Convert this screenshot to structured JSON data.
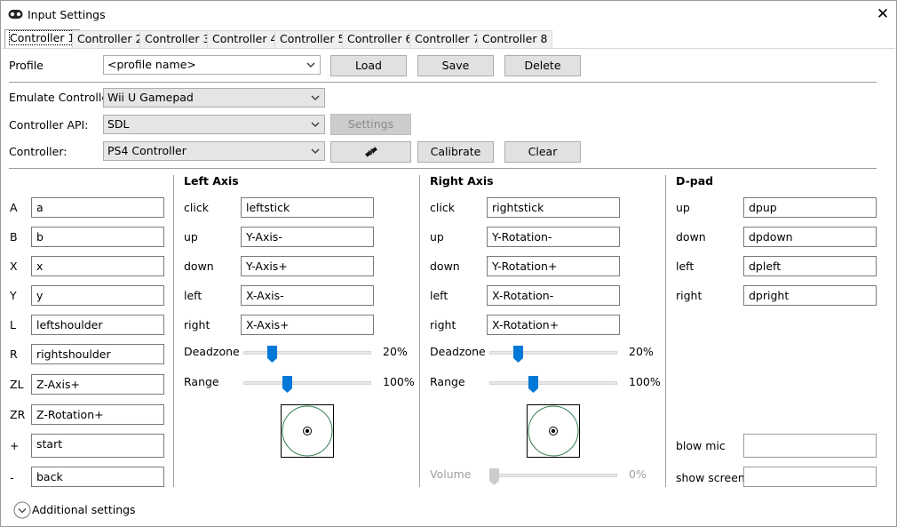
{
  "window": {
    "title": "Input Settings",
    "close_glyph": "✕"
  },
  "tabs": [
    {
      "label": "Controller 1",
      "active": true
    },
    {
      "label": "Controller 2"
    },
    {
      "label": "Controller 3"
    },
    {
      "label": "Controller 4"
    },
    {
      "label": "Controller 5"
    },
    {
      "label": "Controller 6"
    },
    {
      "label": "Controller 7"
    },
    {
      "label": "Controller 8"
    }
  ],
  "profile": {
    "label": "Profile",
    "value": "<profile name>",
    "load": "Load",
    "save": "Save",
    "delete": "Delete"
  },
  "emulate": {
    "label": "Emulate Controller",
    "value": "Wii U Gamepad"
  },
  "api": {
    "label": "Controller API:",
    "value": "SDL",
    "settings": "Settings"
  },
  "controller": {
    "label": "Controller:",
    "value": "PS4 Controller",
    "calibrate": "Calibrate",
    "clear": "Clear",
    "connect_icon": "connect-icon"
  },
  "buttons": [
    {
      "label": "A",
      "value": "a"
    },
    {
      "label": "B",
      "value": "b"
    },
    {
      "label": "X",
      "value": "x"
    },
    {
      "label": "Y",
      "value": "y"
    },
    {
      "label": "L",
      "value": "leftshoulder"
    },
    {
      "label": "R",
      "value": "rightshoulder"
    },
    {
      "label": "ZL",
      "value": "Z-Axis+"
    },
    {
      "label": "ZR",
      "value": "Z-Rotation+"
    },
    {
      "label": "+",
      "value": "start"
    },
    {
      "label": "-",
      "value": "back"
    }
  ],
  "left_axis": {
    "title": "Left Axis",
    "rows": [
      {
        "label": "click",
        "value": "leftstick"
      },
      {
        "label": "up",
        "value": "Y-Axis-"
      },
      {
        "label": "down",
        "value": "Y-Axis+"
      },
      {
        "label": "left",
        "value": "X-Axis-"
      },
      {
        "label": "right",
        "value": "X-Axis+"
      }
    ],
    "deadzone": {
      "label": "Deadzone",
      "value": "20%",
      "fraction": 0.2
    },
    "range": {
      "label": "Range",
      "value": "100%",
      "fraction": 0.33
    }
  },
  "right_axis": {
    "title": "Right Axis",
    "rows": [
      {
        "label": "click",
        "value": "rightstick"
      },
      {
        "label": "up",
        "value": "Y-Rotation-"
      },
      {
        "label": "down",
        "value": "Y-Rotation+"
      },
      {
        "label": "left",
        "value": "X-Rotation-"
      },
      {
        "label": "right",
        "value": "X-Rotation+"
      }
    ],
    "deadzone": {
      "label": "Deadzone",
      "value": "20%",
      "fraction": 0.2
    },
    "range": {
      "label": "Range",
      "value": "100%",
      "fraction": 0.33
    },
    "volume": {
      "label": "Volume",
      "value": "0%",
      "fraction": 0.0
    }
  },
  "dpad": {
    "title": "D-pad",
    "rows": [
      {
        "label": "up",
        "value": "dpup"
      },
      {
        "label": "down",
        "value": "dpdown"
      },
      {
        "label": "left",
        "value": "dpleft"
      },
      {
        "label": "right",
        "value": "dpright"
      }
    ],
    "blow_mic": {
      "label": "blow mic",
      "value": ""
    },
    "show_screen": {
      "label": "show screen",
      "value": ""
    }
  },
  "additional": {
    "label": "Additional settings"
  },
  "colors": {
    "accent": "#0078d7",
    "stick_circle": "#2f7d4f"
  }
}
